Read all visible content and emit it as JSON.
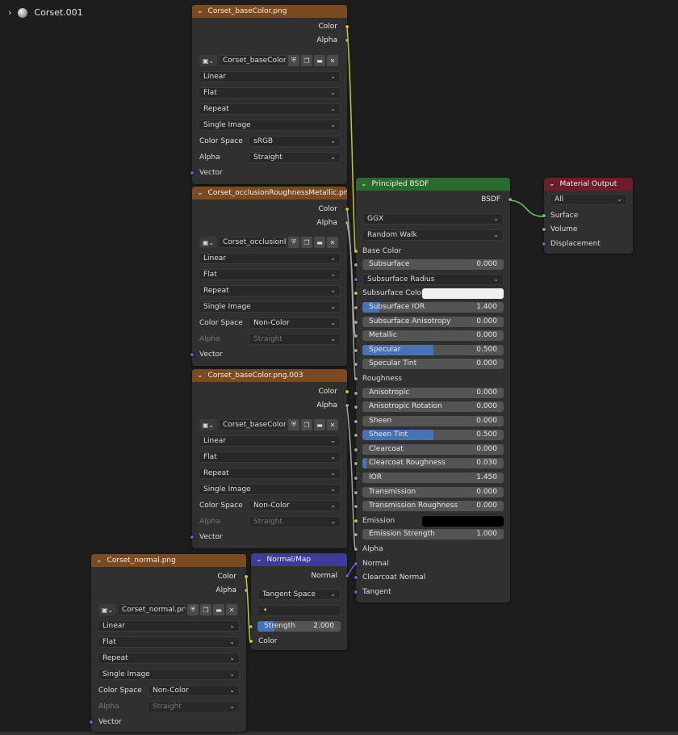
{
  "breadcrumb": {
    "label": "Corset.001"
  },
  "tex1": {
    "title": "Corset_baseColor.png",
    "out_color": "Color",
    "out_alpha": "Alpha",
    "image_name": "Corset_baseColor...",
    "interpolation": "Linear",
    "projection": "Flat",
    "extension": "Repeat",
    "source": "Single Image",
    "colorspace_label": "Color Space",
    "colorspace": "sRGB",
    "alpha_label": "Alpha",
    "alpha_mode": "Straight",
    "in_vector": "Vector"
  },
  "tex2": {
    "title": "Corset_occlusionRoughnessMetallic.png",
    "out_color": "Color",
    "out_alpha": "Alpha",
    "image_name": "Corset_occlusionR...",
    "interpolation": "Linear",
    "projection": "Flat",
    "extension": "Repeat",
    "source": "Single Image",
    "colorspace_label": "Color Space",
    "colorspace": "Non-Color",
    "alpha_label": "Alpha",
    "alpha_mode": "Straight",
    "in_vector": "Vector"
  },
  "tex3": {
    "title": "Corset_baseColor.png.003",
    "out_color": "Color",
    "out_alpha": "Alpha",
    "image_name": "Corset_baseColor...",
    "interpolation": "Linear",
    "projection": "Flat",
    "extension": "Repeat",
    "source": "Single Image",
    "colorspace_label": "Color Space",
    "colorspace": "Non-Color",
    "alpha_label": "Alpha",
    "alpha_mode": "Straight",
    "in_vector": "Vector"
  },
  "tex4": {
    "title": "Corset_normal.png",
    "out_color": "Color",
    "out_alpha": "Alpha",
    "image_name": "Corset_normal.png",
    "interpolation": "Linear",
    "projection": "Flat",
    "extension": "Repeat",
    "source": "Single Image",
    "colorspace_label": "Color Space",
    "colorspace": "Non-Color",
    "alpha_label": "Alpha",
    "alpha_mode": "Straight",
    "in_vector": "Vector"
  },
  "normalmap": {
    "title": "Normal/Map",
    "out_normal": "Normal",
    "space": "Tangent Space",
    "uvmap": "•",
    "strength_label": "Strength",
    "strength_value": "2.000",
    "strength_fraction": 0.2,
    "in_color": "Color"
  },
  "bsdf": {
    "title": "Principled BSDF",
    "out_bsdf": "BSDF",
    "distribution": "GGX",
    "sss_method": "Random Walk",
    "base_color": "Base Color",
    "subsurface": {
      "label": "Subsurface",
      "value": "0.000",
      "fraction": 0
    },
    "subsurface_radius": "Subsurface Radius",
    "subsurface_color": "Subsurface Color",
    "subsurface_ior": {
      "label": "Subsurface IOR",
      "value": "1.400",
      "fraction": 0.12
    },
    "subsurface_aniso": {
      "label": "Subsurface Anisotropy",
      "value": "0.000",
      "fraction": 0
    },
    "metallic": {
      "label": "Metallic",
      "value": "0.000",
      "fraction": 0
    },
    "specular": {
      "label": "Specular",
      "value": "0.500",
      "fraction": 0.5
    },
    "specular_tint": {
      "label": "Specular Tint",
      "value": "0.000",
      "fraction": 0
    },
    "roughness": "Roughness",
    "anisotropic": {
      "label": "Anisotropic",
      "value": "0.000",
      "fraction": 0
    },
    "aniso_rotation": {
      "label": "Anisotropic Rotation",
      "value": "0.000",
      "fraction": 0
    },
    "sheen": {
      "label": "Sheen",
      "value": "0.000",
      "fraction": 0
    },
    "sheen_tint": {
      "label": "Sheen Tint",
      "value": "0.500",
      "fraction": 0.5
    },
    "clearcoat": {
      "label": "Clearcoat",
      "value": "0.000",
      "fraction": 0
    },
    "clearcoat_roughness": {
      "label": "Clearcoat Roughness",
      "value": "0.030",
      "fraction": 0.03
    },
    "ior": {
      "label": "IOR",
      "value": "1.450",
      "fraction": 0
    },
    "transmission": {
      "label": "Transmission",
      "value": "0.000",
      "fraction": 0
    },
    "transmission_roughness": {
      "label": "Transmission Roughness",
      "value": "0.000",
      "fraction": 0
    },
    "emission": "Emission",
    "emission_strength": {
      "label": "Emission Strength",
      "value": "1.000",
      "fraction": 0
    },
    "alpha": "Alpha",
    "normal": "Normal",
    "clearcoat_normal": "Clearcoat Normal",
    "tangent": "Tangent",
    "subsurface_color_hex": "#f0f0f0",
    "emission_color_hex": "#000000"
  },
  "output": {
    "title": "Material Output",
    "target": "All",
    "surface": "Surface",
    "volume": "Volume",
    "displacement": "Displacement"
  },
  "colors": {
    "texture_header": "#7a4a20",
    "shader_header": "#2a6a2e",
    "output_header": "#6a1e2a",
    "vector_header": "#3c3c9a",
    "slider_fill": "#4772b3"
  }
}
